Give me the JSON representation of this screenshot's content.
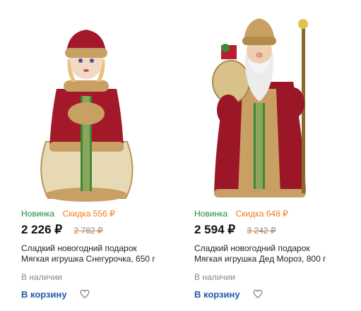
{
  "products": [
    {
      "image_icon": "snegurochka-figure-icon",
      "badge_new": "Новинка",
      "badge_sale": "Скидка 556 ₽",
      "price": "2 226 ₽",
      "old_price": "2 782 ₽",
      "title": "Сладкий новогодний подарок Мягкая игрушка Снегурочка, 650 г",
      "availability": "В наличии",
      "cart_label": "В корзину"
    },
    {
      "image_icon": "ded-moroz-figure-icon",
      "badge_new": "Новинка",
      "badge_sale": "Скидка 648 ₽",
      "price": "2 594 ₽",
      "old_price": "3 242 ₽",
      "title": "Сладкий новогодний подарок Мягкая игрушка Дед Мороз, 800 г",
      "availability": "В наличии",
      "cart_label": "В корзину"
    }
  ],
  "colors": {
    "badge_new": "#1f8a3a",
    "badge_sale": "#f27a1a",
    "link": "#2458a8",
    "muted": "#888888"
  }
}
